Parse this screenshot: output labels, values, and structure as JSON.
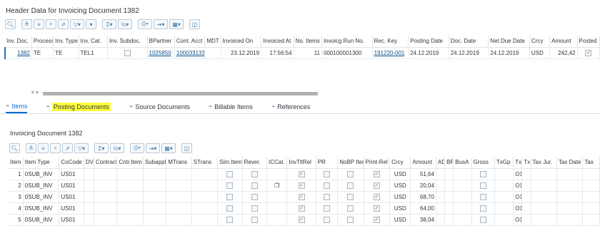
{
  "header": {
    "title": "Header Data for Invoicing Document 1382"
  },
  "toolbar_icons": [
    "find-icon",
    "align-icon",
    "filter-list-icon",
    "search-icon",
    "select-icon",
    "filter-icon",
    "chevron-icon",
    "sum-icon",
    "chevron-icon",
    "subtotal-icon",
    "chevron-icon",
    "print-icon",
    "chevron-icon",
    "export-icon",
    "chevron-icon",
    "layout-icon",
    "chevron-icon",
    "detail-icon"
  ],
  "header_table": {
    "columns": [
      "Inv. Doc.",
      "Process",
      "Inv. Type",
      "Inv. Cat.",
      "Inv. Subdoc.",
      "BPartner",
      "Cont. Acct",
      "MDT",
      "Invoiced On",
      "Invoiced At",
      "No. Items",
      "Invoicg Run No.",
      "Rec. Key",
      "Posting Date",
      "Doc. Date",
      "Net Due Date",
      "Crcy",
      "Amount",
      "Posted"
    ],
    "row": [
      "1382",
      "TE",
      "TE",
      "TEL1",
      "",
      "1025850",
      "100033133",
      "",
      "23.12.2019",
      "17:56:54",
      "11",
      "000100001300",
      "191220-001",
      "24.12.2019",
      "24.12.2019",
      "24.12.2019",
      "USD",
      "242,42",
      "✓"
    ]
  },
  "scroll_arrows": "< >",
  "tabs": [
    {
      "label": "Items",
      "icon": "items-icon",
      "active": true
    },
    {
      "label": "Posting Documents",
      "icon": "posting-icon",
      "active": false
    },
    {
      "label": "Source Documents",
      "icon": "source-icon",
      "active": false
    },
    {
      "label": "Billable Items",
      "icon": "billable-icon",
      "active": false
    },
    {
      "label": "References",
      "icon": "references-icon",
      "active": false
    }
  ],
  "items_section": {
    "title": "Invoicing Document 1382"
  },
  "items_table": {
    "columns": [
      "Item",
      "Item Type",
      "CoCode",
      "DV",
      "Contract",
      "Cntr.Item",
      "Subappl",
      "MTrans",
      "STrans",
      "Sim.Item",
      "Rever.",
      "ICCat.",
      "InvTtlRel",
      "PR",
      "NoBP Item",
      "Print-Rel",
      "Crcy",
      "Amount",
      "AD",
      "BP",
      "BusA",
      "Gross",
      "TxGp",
      "Tx",
      "Tx",
      "Tax Jur.",
      "Tax Date",
      "Tax"
    ],
    "rows": [
      {
        "item": "1",
        "type": "0SUB_INV",
        "cocode": "US01",
        "crcy": "USD",
        "amount": "51,64",
        "tx": "O1",
        "icc": ""
      },
      {
        "item": "2",
        "type": "0SUB_INV",
        "cocode": "US01",
        "crcy": "USD",
        "amount": "20,04",
        "tx": "O1",
        "icc": "❐"
      },
      {
        "item": "3",
        "type": "0SUB_INV",
        "cocode": "US01",
        "crcy": "USD",
        "amount": "68,70",
        "tx": "O1",
        "icc": ""
      },
      {
        "item": "4",
        "type": "0SUB_INV",
        "cocode": "US01",
        "crcy": "USD",
        "amount": "64,00",
        "tx": "O1",
        "icc": ""
      },
      {
        "item": "5",
        "type": "0SUB_INV",
        "cocode": "US01",
        "crcy": "USD",
        "amount": "38,04",
        "tx": "O1",
        "icc": ""
      }
    ]
  },
  "colors": {
    "link": "#0a4f8a",
    "accent": "#0a6ed1",
    "highlight": "#ffff3c"
  }
}
